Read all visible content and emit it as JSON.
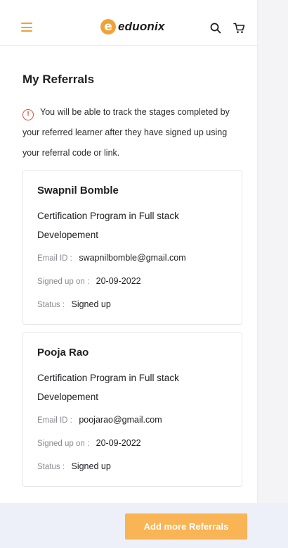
{
  "header": {
    "logo_letter": "e",
    "logo_text": "eduonix",
    "icons": {
      "menu": "hamburger-icon",
      "search": "search-icon",
      "cart": "cart-icon"
    }
  },
  "page": {
    "title": "My Referrals",
    "info_icon_glyph": "!",
    "info_text": "You will be able to track the stages completed by your referred learner after they have signed up using your referral code or link."
  },
  "referrals": [
    {
      "name": "Swapnil Bomble",
      "program": "Certification Program in Full stack Developement",
      "email_label": "Email ID :",
      "email": "swapnilbomble@gmail.com",
      "signed_label": "Signed up on :",
      "signed_date": "20-09-2022",
      "status_label": "Status :",
      "status": "Signed up"
    },
    {
      "name": "Pooja Rao",
      "program": "Certification Program in Full stack Developement",
      "email_label": "Email ID :",
      "email": "poojarao@gmail.com",
      "signed_label": "Signed up on :",
      "signed_date": "20-09-2022",
      "status_label": "Status :",
      "status": "Signed up"
    }
  ],
  "footer": {
    "add_button": "Add more Referrals"
  },
  "colors": {
    "accent": "#f0a236",
    "button": "#f8b455",
    "info": "#e24a3b",
    "footer_bg": "#edf0f8"
  }
}
